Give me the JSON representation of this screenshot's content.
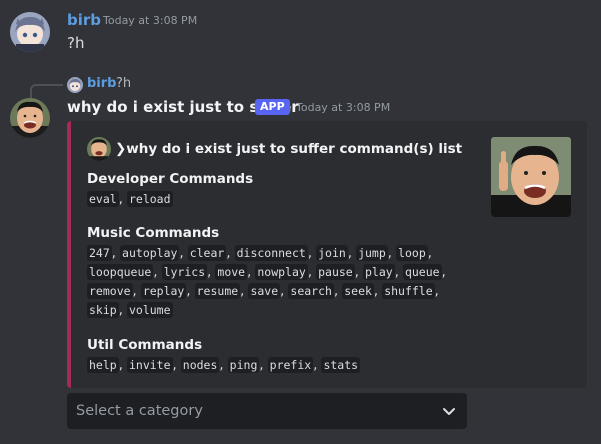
{
  "messages": [
    {
      "username": "birb",
      "timestamp": "Today at 3:08 PM",
      "content": "?h",
      "avatar_icon": "anime-avatar"
    },
    {
      "username": "why do i exist just to suffer",
      "badge": "APP",
      "timestamp": "Today at 3:08 PM",
      "avatar_icon": "man-avatar",
      "reply": {
        "username": "birb",
        "text": "?h"
      },
      "embed": {
        "title": "❯why do i exist just to suffer command(s) list",
        "accent_color": "#a52a54",
        "fields": [
          {
            "name": "Developer Commands",
            "commands": [
              "eval",
              "reload"
            ]
          },
          {
            "name": "Music Commands",
            "commands": [
              "247",
              "autoplay",
              "clear",
              "disconnect",
              "join",
              "jump",
              "loop",
              "loopqueue",
              "lyrics",
              "move",
              "nowplay",
              "pause",
              "play",
              "queue",
              "remove",
              "replay",
              "resume",
              "save",
              "search",
              "seek",
              "shuffle",
              "skip",
              "volume"
            ]
          },
          {
            "name": "Util Commands",
            "commands": [
              "help",
              "invite",
              "nodes",
              "ping",
              "prefix",
              "stats"
            ]
          }
        ]
      }
    }
  ],
  "select_menu": {
    "placeholder": "Select a category"
  },
  "colors": {
    "background": "#313338",
    "embed_background": "#2b2d31",
    "app_badge": "#5865f2",
    "username_blue": "#5a9de0"
  }
}
